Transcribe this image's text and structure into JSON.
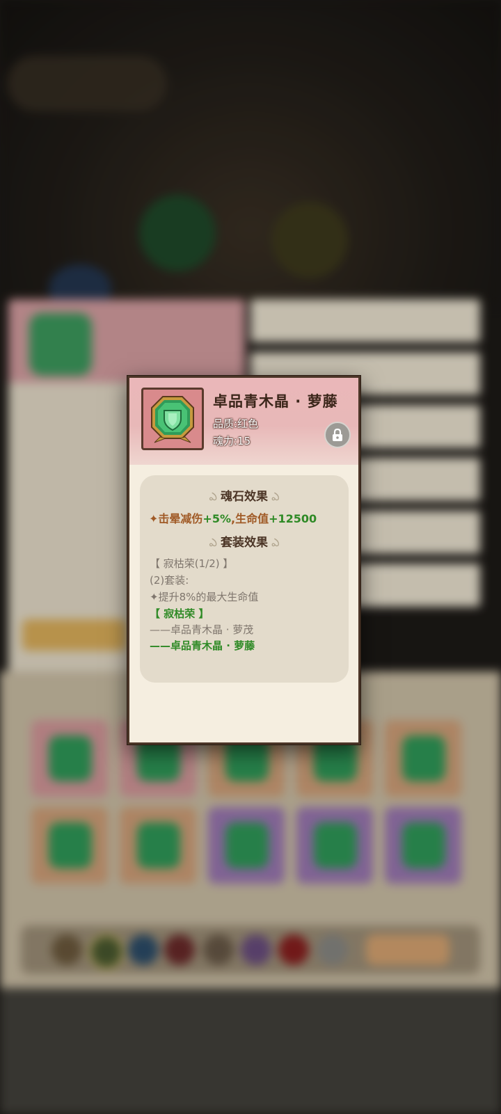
{
  "popup": {
    "item_name": "卓品青木晶 · 萝藤",
    "quality": "品质:红色",
    "soul_power": "魂力:15",
    "lock_icon": "lock-icon",
    "soul_effect_title": "魂石效果",
    "soul_effect_stats": {
      "bullet": "✦",
      "stun_label": "击晕减伤",
      "stun_value": "+5%",
      "separator": ",",
      "hp_label": "生命值",
      "hp_value": "+12500"
    },
    "set_effect_title": "套装效果",
    "set_name_count": "【 寂枯荣(1/2) 】",
    "set_two_piece": "(2)套装:",
    "set_bonus": "✦提升8%的最大生命值",
    "set_name_active": "【 寂枯荣 】",
    "set_pieces": [
      {
        "label": "——卓品青木晶 · 萝茂",
        "owned": false
      },
      {
        "label": "——卓品青木晶 · 萝藤",
        "owned": true
      }
    ]
  },
  "colors": {
    "header_pink": "#eab7b9",
    "effect_brown": "#a05a26",
    "effect_green": "#2f8a26",
    "inactive_gray": "#7f766d"
  }
}
